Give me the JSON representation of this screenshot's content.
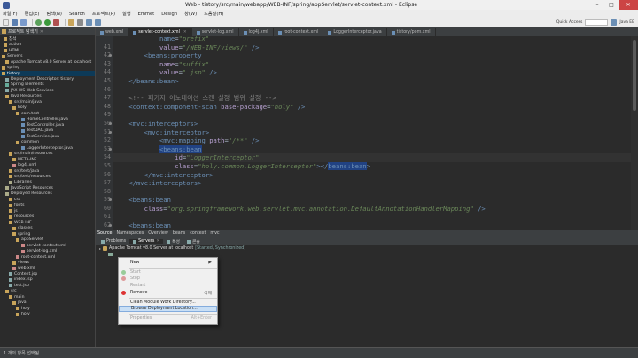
{
  "window": {
    "title": "Web - tistory/src/main/webapp/WEB-INF/spring/appServlet/servlet-context.xml - Eclipse",
    "min": "–",
    "max": "□",
    "close": "✕"
  },
  "menu": [
    "파일(F)",
    "편집(E)",
    "탐색(N)",
    "Search",
    "프로젝트(P)",
    "실행",
    "Emmet",
    "Design",
    "창(W)",
    "도움말(H)"
  ],
  "quick_access": "Quick Access",
  "perspective": "Java EE",
  "left": {
    "tab_label": "프로젝트 탐색기",
    "close": "✕",
    "tree": [
      {
        "label": "참석",
        "indent": 4,
        "color": "#c8a45a"
      },
      {
        "label": "action",
        "indent": 4,
        "color": "#c8a45a"
      },
      {
        "label": "HTML",
        "indent": 4,
        "color": "#c8a45a"
      },
      {
        "label": "Servers",
        "indent": 2,
        "color": "#c8a45a"
      },
      {
        "label": "Apache Tomcat v8.0 Server at localhost",
        "indent": 6,
        "color": "#c8a45a"
      },
      {
        "label": "spring",
        "indent": 2,
        "color": "#c8a45a"
      },
      {
        "label": "tistory",
        "indent": 2,
        "color": "#c8a45a",
        "selected": true
      },
      {
        "label": "Deployment Descriptor: tistory",
        "indent": 6,
        "color": "#8aa"
      },
      {
        "label": "Spring Elements",
        "indent": 6,
        "color": "#6a9"
      },
      {
        "label": "JAX-WS Web Services",
        "indent": 6,
        "color": "#8aa"
      },
      {
        "label": "Java Resources",
        "indent": 6,
        "color": "#c8a45a"
      },
      {
        "label": "src/main/java",
        "indent": 10,
        "color": "#c8a45a"
      },
      {
        "label": "holy",
        "indent": 14,
        "color": "#c8a45a"
      },
      {
        "label": "com.test",
        "indent": 18,
        "color": "#c8a45a"
      },
      {
        "label": "HomeController.java",
        "indent": 24,
        "color": "#6b8fb5"
      },
      {
        "label": "TestController.java",
        "indent": 24,
        "color": "#6b8fb5"
      },
      {
        "label": "TestDAO.java",
        "indent": 24,
        "color": "#6b8fb5"
      },
      {
        "label": "TestService.java",
        "indent": 24,
        "color": "#6b8fb5"
      },
      {
        "label": "common",
        "indent": 18,
        "color": "#c8a45a"
      },
      {
        "label": "LoggerInterceptor.java",
        "indent": 24,
        "color": "#6b8fb5"
      },
      {
        "label": "src/main/resources",
        "indent": 10,
        "color": "#c8a45a"
      },
      {
        "label": "META-INF",
        "indent": 14,
        "color": "#c8a45a"
      },
      {
        "label": "log4j.xml",
        "indent": 14,
        "color": "#c88"
      },
      {
        "label": "src/test/java",
        "indent": 10,
        "color": "#c8a45a"
      },
      {
        "label": "src/test/resources",
        "indent": 10,
        "color": "#c8a45a"
      },
      {
        "label": "Libraries",
        "indent": 10,
        "color": "#aa8"
      },
      {
        "label": "JavaScript Resources",
        "indent": 6,
        "color": "#aa8"
      },
      {
        "label": "Deployed Resources",
        "indent": 6,
        "color": "#aa8"
      },
      {
        "label": "css",
        "indent": 10,
        "color": "#c8a45a"
      },
      {
        "label": "fonts",
        "indent": 10,
        "color": "#c8a45a"
      },
      {
        "label": "js",
        "indent": 10,
        "color": "#c8a45a"
      },
      {
        "label": "resources",
        "indent": 10,
        "color": "#c8a45a"
      },
      {
        "label": "WEB-INF",
        "indent": 10,
        "color": "#c8a45a"
      },
      {
        "label": "classes",
        "indent": 14,
        "color": "#c8a45a"
      },
      {
        "label": "spring",
        "indent": 14,
        "color": "#c8a45a"
      },
      {
        "label": "appServlet",
        "indent": 18,
        "color": "#c8a45a"
      },
      {
        "label": "servlet-context.xml",
        "indent": 24,
        "color": "#c88"
      },
      {
        "label": "servlet-log.xml",
        "indent": 24,
        "color": "#c88"
      },
      {
        "label": "root-context.xml",
        "indent": 18,
        "color": "#c88"
      },
      {
        "label": "views",
        "indent": 14,
        "color": "#c8a45a"
      },
      {
        "label": "web.xml",
        "indent": 14,
        "color": "#c88"
      },
      {
        "label": "Content.jsp",
        "indent": 10,
        "color": "#8aa"
      },
      {
        "label": "index.jsp",
        "indent": 10,
        "color": "#8aa"
      },
      {
        "label": "test.jsp",
        "indent": 10,
        "color": "#8aa"
      },
      {
        "label": "src",
        "indent": 6,
        "color": "#c8a45a"
      },
      {
        "label": "main",
        "indent": 10,
        "color": "#c8a45a"
      },
      {
        "label": "java",
        "indent": 14,
        "color": "#c8a45a"
      },
      {
        "label": "holy",
        "indent": 18,
        "color": "#c8a45a"
      },
      {
        "label": "holy",
        "indent": 18,
        "color": "#c8a45a"
      }
    ]
  },
  "editor_tabs": [
    {
      "label": "web.xml",
      "active": false
    },
    {
      "label": "servlet-context.xml",
      "active": true
    },
    {
      "label": "servlet-log.xml",
      "active": false
    },
    {
      "label": "log4j.xml",
      "active": false
    },
    {
      "label": "root-context.xml",
      "active": false
    },
    {
      "label": "LoggerInterceptor.java",
      "active": false
    },
    {
      "label": "tistory/pom.xml",
      "active": false
    }
  ],
  "code_lines": [
    {
      "n": "",
      "cur": false,
      "parts": [
        [
          "t",
          "            "
        ],
        [
          "tag",
          "name"
        ],
        [
          "t",
          "="
        ],
        [
          "str",
          "\"prefix\""
        ]
      ]
    },
    {
      "n": "41",
      "cur": false,
      "parts": [
        [
          "t",
          "            "
        ],
        [
          "at",
          "value"
        ],
        [
          "t",
          "="
        ],
        [
          "str",
          "\"/WEB-INF/views/\""
        ],
        [
          "tag",
          " />"
        ]
      ]
    },
    {
      "n": "42",
      "cur": false,
      "parts": [
        [
          "t",
          "        "
        ],
        [
          "tag",
          "<beans:property"
        ]
      ]
    },
    {
      "n": "43",
      "cur": false,
      "parts": [
        [
          "t",
          "            "
        ],
        [
          "at",
          "name"
        ],
        [
          "t",
          "="
        ],
        [
          "str",
          "\"suffix\""
        ]
      ]
    },
    {
      "n": "44",
      "cur": false,
      "parts": [
        [
          "t",
          "            "
        ],
        [
          "at",
          "value"
        ],
        [
          "t",
          "="
        ],
        [
          "str",
          "\".jsp\""
        ],
        [
          "tag",
          " />"
        ]
      ]
    },
    {
      "n": "45",
      "cur": false,
      "parts": [
        [
          "t",
          "    "
        ],
        [
          "tag",
          "</beans:bean>"
        ]
      ]
    },
    {
      "n": "46",
      "cur": false,
      "parts": []
    },
    {
      "n": "47",
      "cur": false,
      "parts": [
        [
          "t",
          "    "
        ],
        [
          "com",
          "<!-- 패키지 어노테이션 스캔 설정 범위 설정 -->"
        ]
      ]
    },
    {
      "n": "48",
      "cur": false,
      "parts": [
        [
          "t",
          "    "
        ],
        [
          "tag",
          "<context:component-scan"
        ],
        [
          "at",
          " base-package"
        ],
        [
          "t",
          "="
        ],
        [
          "str",
          "\"holy\""
        ],
        [
          "tag",
          " />"
        ]
      ]
    },
    {
      "n": "49",
      "cur": false,
      "parts": []
    },
    {
      "n": "50",
      "cur": false,
      "parts": [
        [
          "t",
          "    "
        ],
        [
          "tag",
          "<mvc:interceptors>"
        ]
      ]
    },
    {
      "n": "51",
      "cur": false,
      "parts": [
        [
          "t",
          "        "
        ],
        [
          "tag",
          "<mvc:interceptor>"
        ]
      ]
    },
    {
      "n": "52",
      "cur": false,
      "parts": [
        [
          "t",
          "            "
        ],
        [
          "tag",
          "<mvc:mapping"
        ],
        [
          "at",
          " path"
        ],
        [
          "t",
          "="
        ],
        [
          "str",
          "\"/**\""
        ],
        [
          "tag",
          " />"
        ]
      ]
    },
    {
      "n": "53",
      "cur": false,
      "parts": [
        [
          "t",
          "            "
        ],
        [
          "hl",
          "<beans:bean"
        ]
      ]
    },
    {
      "n": "54",
      "cur": true,
      "parts": [
        [
          "t",
          "                "
        ],
        [
          "at",
          "id"
        ],
        [
          "t",
          "="
        ],
        [
          "str",
          "\"LoggerInterceptor\""
        ]
      ]
    },
    {
      "n": "55",
      "cur": false,
      "parts": [
        [
          "t",
          "                "
        ],
        [
          "at",
          "class"
        ],
        [
          "t",
          "="
        ],
        [
          "str",
          "\"holy.common.LoggerInterceptor\""
        ],
        [
          "tag",
          "></"
        ],
        [
          "hl",
          "beans:bean"
        ],
        [
          "tag",
          ">"
        ]
      ]
    },
    {
      "n": "56",
      "cur": false,
      "parts": [
        [
          "t",
          "        "
        ],
        [
          "tag",
          "</mvc:interceptor>"
        ]
      ]
    },
    {
      "n": "57",
      "cur": false,
      "parts": [
        [
          "t",
          "    "
        ],
        [
          "tag",
          "</mvc:interceptors>"
        ]
      ]
    },
    {
      "n": "58",
      "cur": false,
      "parts": []
    },
    {
      "n": "59",
      "cur": false,
      "parts": [
        [
          "t",
          "    "
        ],
        [
          "tag",
          "<beans:bean"
        ]
      ]
    },
    {
      "n": "60",
      "cur": false,
      "parts": [
        [
          "t",
          "        "
        ],
        [
          "at",
          "class"
        ],
        [
          "t",
          "="
        ],
        [
          "str",
          "\"org.springframework.web.servlet.mvc.annotation.DefaultAnnotationHandlerMapping\""
        ],
        [
          "tag",
          " />"
        ]
      ]
    },
    {
      "n": "61",
      "cur": false,
      "parts": []
    },
    {
      "n": "62",
      "cur": false,
      "parts": [
        [
          "t",
          "    "
        ],
        [
          "tag",
          "<beans:bean"
        ]
      ]
    }
  ],
  "editor_bottom_tabs": [
    "Source",
    "Namespaces",
    "Overview",
    "beans",
    "context",
    "mvc"
  ],
  "view_tabs": [
    {
      "label": "Problems",
      "active": false
    },
    {
      "label": "Servers",
      "active": true
    },
    {
      "label": "특성",
      "active": false
    },
    {
      "label": "콘솔",
      "active": false
    }
  ],
  "server": {
    "name": "Apache Tomcat v8.0 Server at localhost",
    "status": "[Started, Synchronized]"
  },
  "context_menu": [
    {
      "label": "New",
      "shortcut": "",
      "arrow": "▶",
      "disabled": false,
      "icon": ""
    },
    {
      "sep": true
    },
    {
      "label": "Start",
      "shortcut": "",
      "disabled": true,
      "icon": "#9c9"
    },
    {
      "label": "Stop",
      "shortcut": "",
      "disabled": true,
      "icon": "#d99"
    },
    {
      "label": "Restart",
      "shortcut": "",
      "disabled": true,
      "icon": ""
    },
    {
      "label": "Remove",
      "shortcut": "삭제",
      "disabled": false,
      "icon": "#d33"
    },
    {
      "sep": true
    },
    {
      "label": "Clean Module Work Directory...",
      "shortcut": "",
      "disabled": false,
      "icon": ""
    },
    {
      "label": "Browse Deployment Location...",
      "shortcut": "",
      "disabled": false,
      "highlight": true,
      "icon": ""
    },
    {
      "sep": true
    },
    {
      "label": "Properties",
      "shortcut": "Alt+Enter",
      "disabled": true,
      "icon": ""
    }
  ],
  "status": "1 개의 항목 선택됨"
}
